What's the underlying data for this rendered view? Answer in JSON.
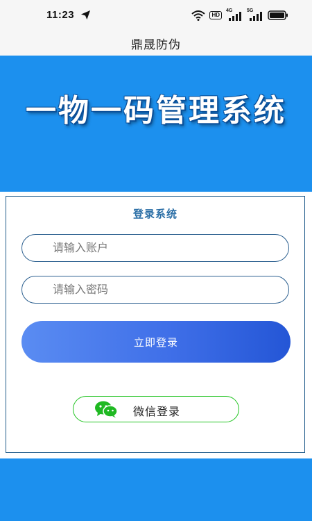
{
  "status_bar": {
    "time": "11:23",
    "hd_badge": "HD",
    "sim1_tag": "4G",
    "sim2_tag": "5G"
  },
  "header": {
    "title": "鼎晟防伪"
  },
  "banner": {
    "title": "一物一码管理系统"
  },
  "login": {
    "panel_title": "登录系统",
    "account_placeholder": "请输入账户",
    "password_placeholder": "请输入密码",
    "submit_label": "立即登录",
    "wechat_label": "微信登录"
  },
  "icons": {
    "send": "send-icon",
    "wifi": "wifi-icon",
    "battery": "battery-icon",
    "wechat": "wechat-icon"
  },
  "colors": {
    "brand_blue": "#1c90ee",
    "panel_border": "#1e5a8a",
    "button_gradient_start": "#5a8cf2",
    "button_gradient_end": "#2456d6",
    "wechat_green": "#21c421"
  }
}
